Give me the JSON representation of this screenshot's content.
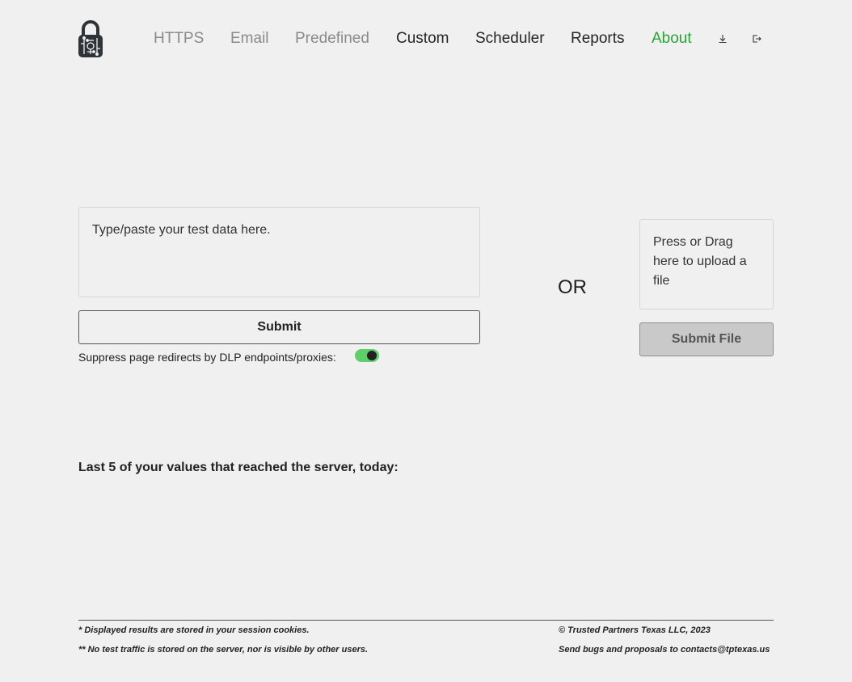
{
  "nav": {
    "items": [
      {
        "label": "HTTPS",
        "state": "disabled"
      },
      {
        "label": "Email",
        "state": "disabled"
      },
      {
        "label": "Predefined",
        "state": "disabled"
      },
      {
        "label": "Custom",
        "state": "normal"
      },
      {
        "label": "Scheduler",
        "state": "normal"
      },
      {
        "label": "Reports",
        "state": "normal"
      },
      {
        "label": "About",
        "state": "active"
      }
    ],
    "icons": [
      "download-icon",
      "logout-icon"
    ]
  },
  "form": {
    "placeholder": "Type/paste your test data here.",
    "submit_label": "Submit",
    "suppress_label": "Suppress page redirects by DLP endpoints/proxies:",
    "suppress_enabled": true,
    "or_label": "OR",
    "upload_label": "Press or Drag here to upload a file",
    "submit_file_label": "Submit File"
  },
  "results": {
    "heading": "Last 5 of your values that reached the server, today:"
  },
  "footer": {
    "note1": "* Displayed results are stored in your session cookies.",
    "note2": "** No test traffic is stored on the server, nor is visible by other users.",
    "copyright": "© Trusted Partners Texas LLC, 2023",
    "contact": "Send bugs and proposals to contacts@tptexas.us"
  },
  "colors": {
    "background": "#f0f0f0",
    "active_nav": "#27a534",
    "disabled_nav": "#8a8a8a",
    "toggle_on": "#5fcf6b"
  }
}
